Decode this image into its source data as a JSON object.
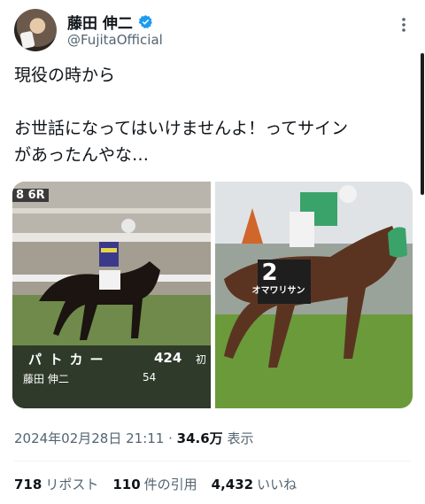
{
  "author": {
    "name": "藤田 伸二",
    "handle": "@FujitaOfficial",
    "verified": true
  },
  "tweet": {
    "text": "現役の時から\n\nお世話になってはいけませんよ！ってサイン\nがあったんやな…"
  },
  "media": {
    "left_photo": {
      "race": "8 6R",
      "horse": "パトカー",
      "weight": "424",
      "extra": "初",
      "jockey": "藤田 伸二",
      "number": "54"
    },
    "right_photo": {
      "saddle_number": "2",
      "horse_name": "オマワリサン"
    }
  },
  "meta": {
    "datetime": "2024年02月28日 21:11",
    "separator": " · ",
    "views": "34.6万",
    "views_label": " 表示"
  },
  "stats": {
    "reposts": "718",
    "reposts_label": "リポスト",
    "quotes": "110",
    "quotes_label": "件の引用",
    "likes": "4,432",
    "likes_label": "いいね"
  },
  "colors": {
    "verified": "#1d9bf0",
    "secondary_text": "#536471",
    "primary_text": "#0f1419"
  },
  "icons": {
    "verified": "verified-badge-icon",
    "more": "more-dots-icon"
  }
}
